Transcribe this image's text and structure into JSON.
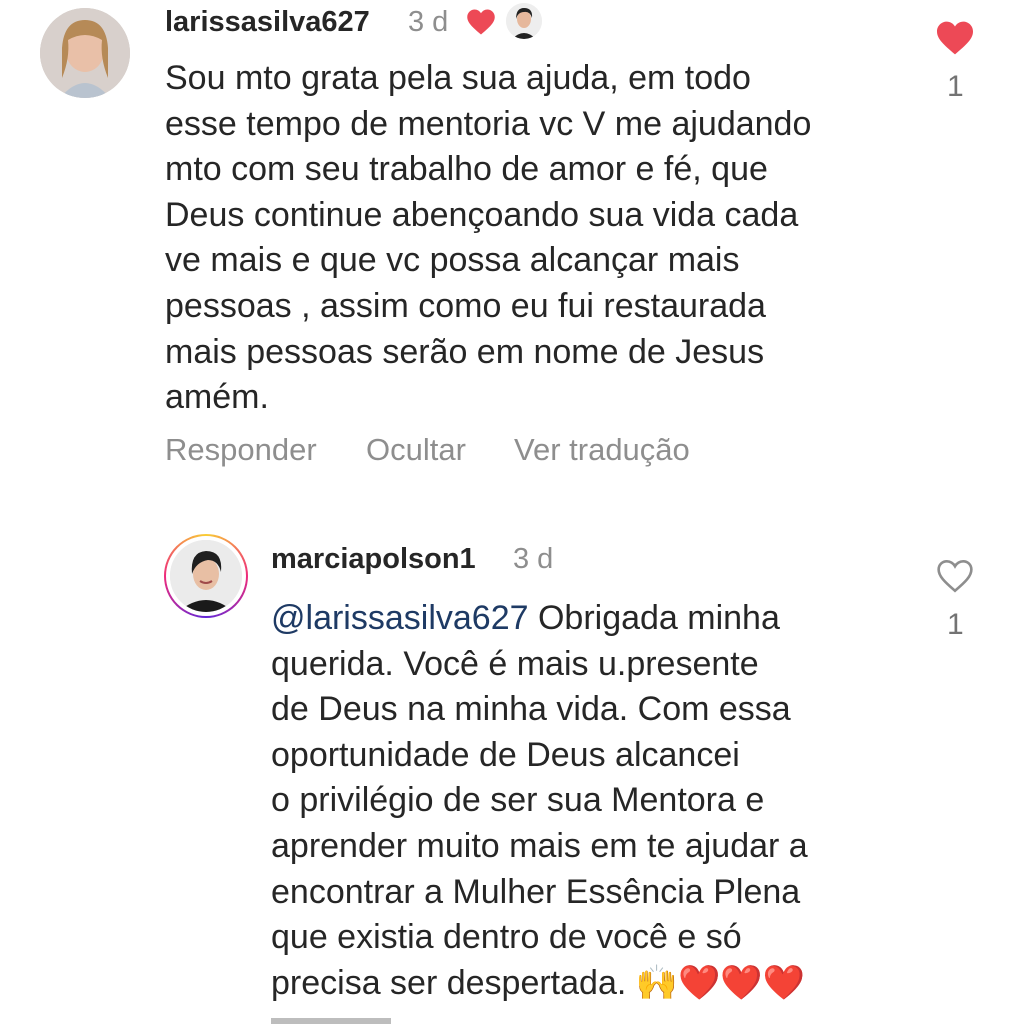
{
  "comment": {
    "username": "larissasilva627",
    "time": "3 d",
    "text_lines": [
      "Sou mto grata pela sua ajuda, em todo",
      "esse tempo de mentoria vc V me ajudando",
      "mto com seu trabalho de amor e fé,  que",
      "Deus continue abençoando sua vida cada",
      "ve mais e que vc possa alcançar mais",
      "pessoas , assim como eu fui restaurada",
      "mais pessoas serão em nome de Jesus",
      "amém."
    ],
    "like_count": "1",
    "actions": {
      "reply": "Responder",
      "hide": "Ocultar",
      "translate": "Ver tradução"
    }
  },
  "reply": {
    "username": "marciapolson1",
    "time": "3 d",
    "mention": "@larissasilva627",
    "first_line_rest": " Obrigada minha",
    "text_lines": [
      "querida. Você é mais u.presente",
      "de Deus na minha vida. Com essa",
      "oportunidade de Deus alcancei",
      "o privilégio de ser sua Mentora e",
      "aprender muito mais em te ajudar a",
      "encontrar a Mulher Essência Plena",
      "que existia dentro de você e só"
    ],
    "last_line": "precisa ser despertada. ",
    "last_line_emoji": "🙌❤️❤️❤️",
    "like_count": "1"
  },
  "colors": {
    "liked_heart": "#ed4956",
    "secondary_text": "#8e8e8e",
    "mention": "#1e3a64"
  }
}
